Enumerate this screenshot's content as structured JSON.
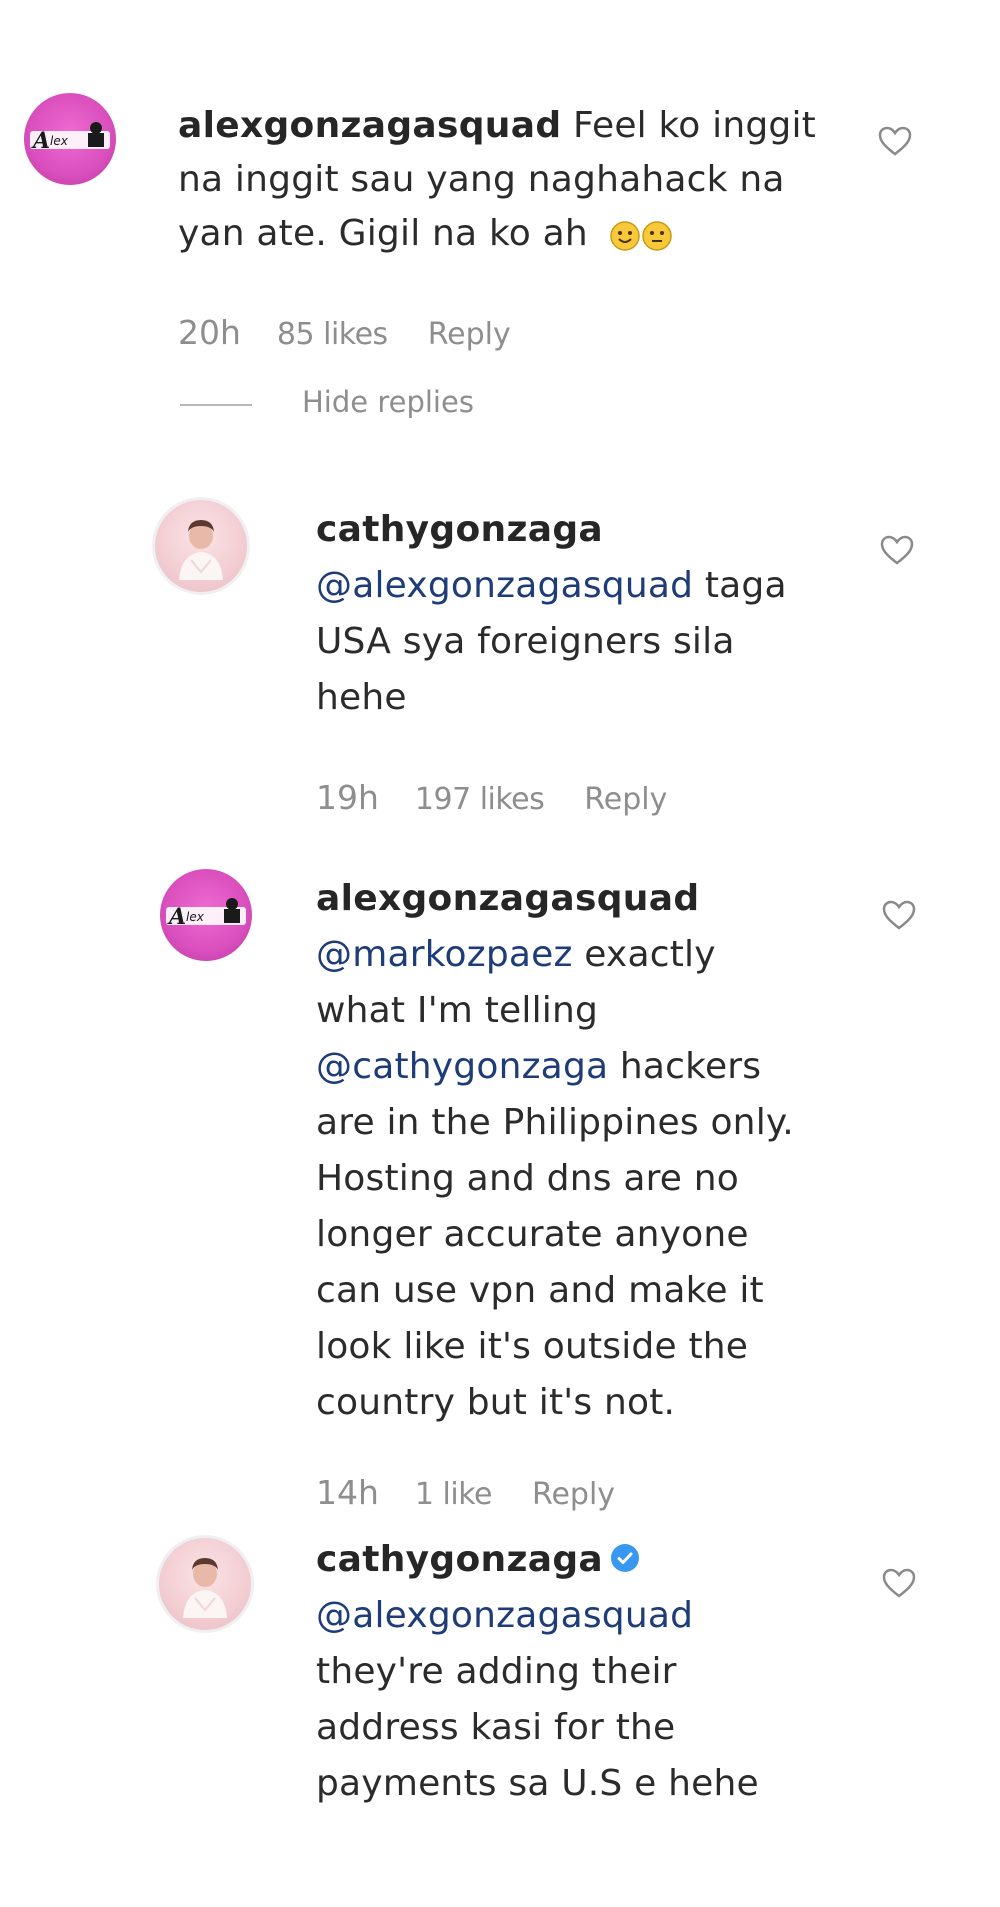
{
  "comments": [
    {
      "username": "alexgonzagasquad",
      "text": " Feel ko inggit",
      "line2": "na inggit sau yang naghahack na",
      "line3": "yan ate. Gigil na ko ah",
      "emoji": [
        "smiling-face-emoji",
        "neutral-face-emoji"
      ],
      "time": "20h",
      "likes": "85 likes",
      "reply": "Reply",
      "hide_replies": "Hide replies"
    },
    {
      "username": "cathygonzaga",
      "mention": "@alexgonzagasquad",
      "text1": " taga",
      "line2": "USA sya foreigners sila",
      "line3": "hehe",
      "time": "19h",
      "likes": "197 likes",
      "reply": "Reply"
    },
    {
      "username": "alexgonzagasquad",
      "mention1": "@markozpaez",
      "text1": " exactly",
      "line2": "what I'm telling",
      "mention2": "@cathygonzaga",
      "text3": " hackers",
      "line4": "are in the Philippines only.",
      "line5": "Hosting and dns are no",
      "line6": "longer accurate anyone",
      "line7": "can use vpn and make it",
      "line8": "look like it's outside the",
      "line9": "country but it's not.",
      "time": "14h",
      "likes": "1 like",
      "reply": "Reply"
    },
    {
      "username": "cathygonzaga",
      "verified": true,
      "mention": "@alexgonzagasquad",
      "line2": "they're adding their",
      "line3": "address kasi for the",
      "line4": "payments sa U.S e hehe"
    }
  ],
  "colors": {
    "text": "#262626",
    "meta": "#8e8e8e",
    "mention": "#1d3c78",
    "verified": "#3897f0",
    "brand_avatar": "#d94fbd"
  },
  "icons": {
    "like": "heart-outline-icon",
    "verified": "verified-badge-icon"
  }
}
